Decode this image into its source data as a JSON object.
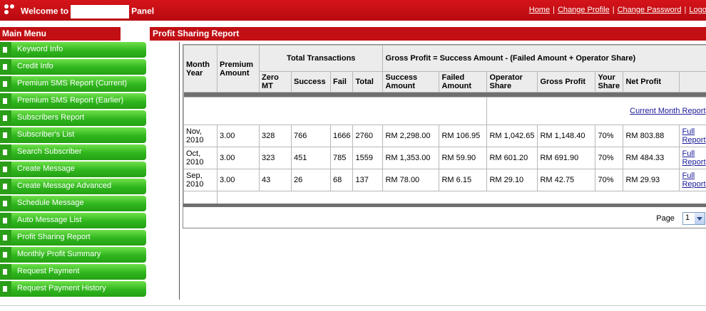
{
  "header": {
    "welcome_prefix": "Welcome to",
    "welcome_suffix": "Panel",
    "links": [
      "Home",
      "Change Profile",
      "Change Password",
      "Logout"
    ]
  },
  "sidebar": {
    "title": "Main Menu",
    "items": [
      "Keyword Info",
      "Credit Info",
      "Premium SMS Report (Current)",
      "Premium SMS Report (Earlier)",
      "Subscribers Report",
      "Subscriber's List",
      "Search Subscriber",
      "Create Message",
      "Create Message Advanced",
      "Schedule Message",
      "Auto Message List",
      "Profit Sharing Report",
      "Monthly Profit Summary",
      "Request Payment",
      "Request Payment History"
    ]
  },
  "report": {
    "title": "Profit Sharing Report",
    "headers": {
      "month_year": "Month Year",
      "premium_amount": "Premium Amount",
      "total_transactions": "Total Transactions",
      "gross_formula": "Gross Profit = Success Amount - (Failed Amount + Operator Share)",
      "zero_mt": "Zero MT",
      "success": "Success",
      "fail": "Fail",
      "total": "Total",
      "success_amount": "Success Amount",
      "failed_amount": "Failed Amount",
      "operator_share": "Operator Share",
      "gross_profit": "Gross Profit",
      "your_share": "Your Share",
      "net_profit": "Net Profit"
    },
    "current_month_link": "Current Month Report",
    "rows": [
      {
        "month": "Nov, 2010",
        "premium": "3.00",
        "zero_mt": "328",
        "success": "766",
        "fail": "1666",
        "total": "2760",
        "success_amount": "RM 2,298.00",
        "failed_amount": "RM 106.95",
        "operator_share": "RM 1,042.65",
        "gross_profit": "RM 1,148.40",
        "your_share": "70%",
        "net_profit": "RM 803.88",
        "link": "Full Report"
      },
      {
        "month": "Oct, 2010",
        "premium": "3.00",
        "zero_mt": "323",
        "success": "451",
        "fail": "785",
        "total": "1559",
        "success_amount": "RM 1,353.00",
        "failed_amount": "RM 59.90",
        "operator_share": "RM 601.20",
        "gross_profit": "RM 691.90",
        "your_share": "70%",
        "net_profit": "RM 484.33",
        "link": "Full Report"
      },
      {
        "month": "Sep, 2010",
        "premium": "3.00",
        "zero_mt": "43",
        "success": "26",
        "fail": "68",
        "total": "137",
        "success_amount": "RM 78.00",
        "failed_amount": "RM 6.15",
        "operator_share": "RM 29.10",
        "gross_profit": "RM 42.75",
        "your_share": "70%",
        "net_profit": "RM 29.93",
        "link": "Full Report"
      }
    ],
    "pager": {
      "label": "Page",
      "value": "1"
    }
  },
  "colors": {
    "brand_red": "#c10f14",
    "menu_green": "#2fb51d",
    "link_blue": "#1a1a99"
  }
}
